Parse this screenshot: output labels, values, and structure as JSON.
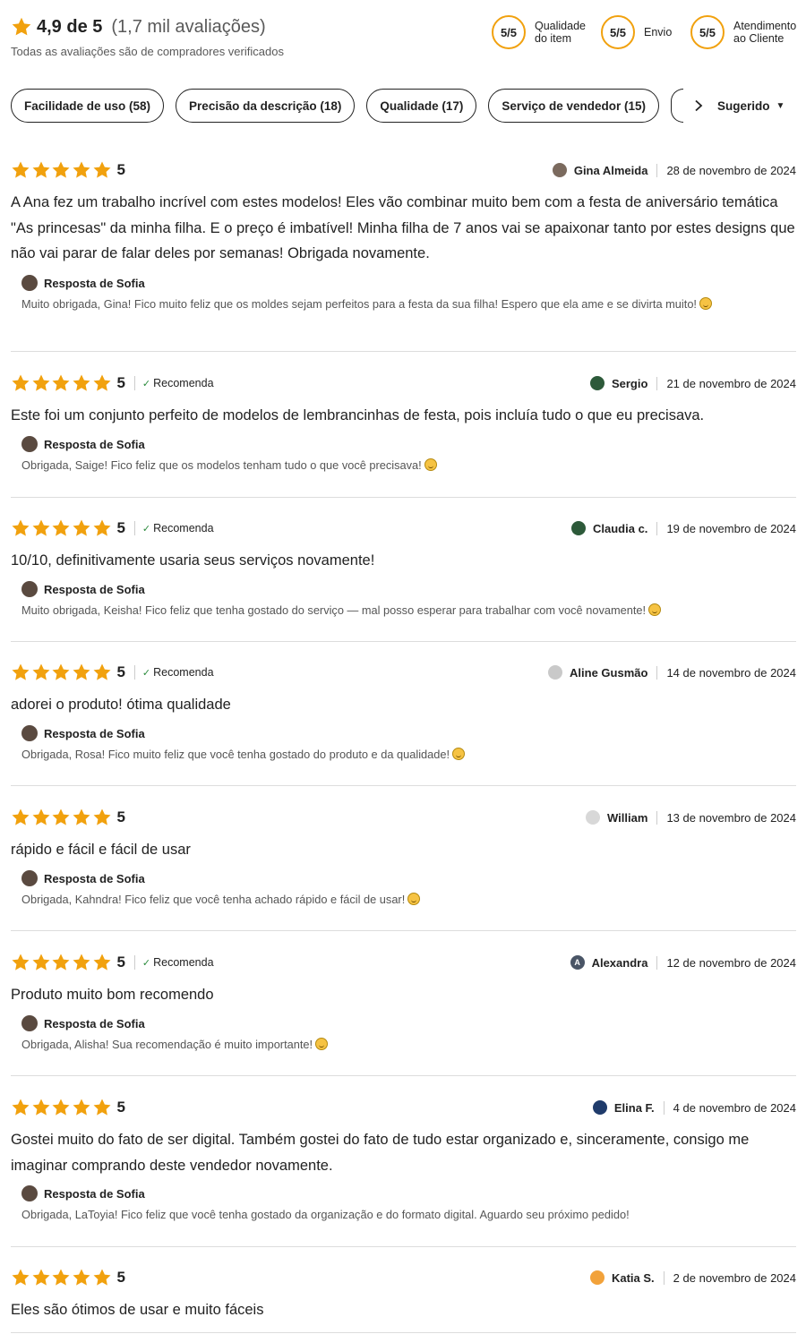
{
  "colors": {
    "star": "#f1a10e",
    "accent_ring": "#f1a10e",
    "check": "#2c8b3d",
    "divider": "#dddddd"
  },
  "header": {
    "rating_value": "4,9 de 5",
    "rating_count": "(1,7 mil avaliações)",
    "verified_note": "Todas as avaliações são de compradores verificados",
    "scores": [
      {
        "value": "5/5",
        "label": "Qualidade do item"
      },
      {
        "value": "5/5",
        "label": "Envio"
      },
      {
        "value": "5/5",
        "label": "Atendimento ao Cliente"
      }
    ]
  },
  "filters": {
    "pills": [
      "Facilidade de uso (58)",
      "Precisão da descrição (18)",
      "Qualidade (17)",
      "Serviço de vendedor (15)"
    ],
    "next_icon": "chevron-right-icon",
    "sort_label": "Sugerido",
    "sort_icon": "caret-down-icon"
  },
  "reviews": [
    {
      "stars": 5,
      "rating": "5",
      "recommends": "",
      "author": "Gina Almeida",
      "avatar_color": "#7b6a5e",
      "avatar_letter": "",
      "date": "28 de novembro de 2024",
      "text": "A Ana fez um trabalho incrível com estes modelos! Eles vão combinar muito bem com a festa de aniversário temática \"As princesas\" da minha filha. E o preço é imbatível! Minha filha de 7 anos vai se apaixonar tanto por estes designs que não vai parar de falar deles por semanas! Obrigada novamente.",
      "response_label": "Resposta de Sofia",
      "response_text": "Muito obrigada, Gina! Fico muito feliz que os moldes sejam perfeitos para a festa da sua filha! Espero que ela ame e se divirta muito!"
    },
    {
      "stars": 5,
      "rating": "5",
      "recommends": "Recomenda",
      "author": "Sergio",
      "avatar_color": "#2d5a3a",
      "avatar_letter": "",
      "date": "21 de novembro de 2024",
      "text": "Este foi um conjunto perfeito de modelos de lembrancinhas de festa, pois incluía tudo o que eu precisava.",
      "response_label": "Resposta de Sofia",
      "response_text": "Obrigada, Saige! Fico feliz que os modelos tenham tudo o que você precisava!"
    },
    {
      "stars": 5,
      "rating": "5",
      "recommends": "Recomenda",
      "author": "Claudia c.",
      "avatar_color": "#2d5a3a",
      "avatar_letter": "",
      "date": "19 de novembro de 2024",
      "text": "10/10, definitivamente usaria seus serviços novamente!",
      "response_label": "Resposta de Sofia",
      "response_text": "Muito obrigada, Keisha! Fico feliz que tenha gostado do serviço — mal posso esperar para trabalhar com você novamente!"
    },
    {
      "stars": 5,
      "rating": "5",
      "recommends": "Recomenda",
      "author": "Aline Gusmão",
      "avatar_color": "#c9c9c9",
      "avatar_letter": "",
      "date": "14 de novembro de 2024",
      "text": "adorei o produto! ótima qualidade",
      "response_label": "Resposta de Sofia",
      "response_text": "Obrigada, Rosa! Fico muito feliz que você tenha gostado do produto e da qualidade!"
    },
    {
      "stars": 5,
      "rating": "5",
      "recommends": "",
      "author": "William",
      "avatar_color": "#d8d8d8",
      "avatar_letter": "",
      "date": "13 de novembro de 2024",
      "text": "rápido e fácil e fácil de usar",
      "response_label": "Resposta de Sofia",
      "response_text": "Obrigada, Kahndra! Fico feliz que você tenha achado rápido e fácil de usar!"
    },
    {
      "stars": 5,
      "rating": "5",
      "recommends": "Recomenda",
      "author": "Alexandra",
      "avatar_color": "#4a5566",
      "avatar_letter": "A",
      "date": "12 de novembro de 2024",
      "text": "Produto muito bom recomendo",
      "response_label": "Resposta de Sofia",
      "response_text": "Obrigada, Alisha! Sua recomendação é muito importante!"
    },
    {
      "stars": 5,
      "rating": "5",
      "recommends": "",
      "author": "Elina F.",
      "avatar_color": "#1f3b6b",
      "avatar_letter": "",
      "date": "4 de novembro de 2024",
      "text": "Gostei muito do fato de ser digital. Também gostei do fato de tudo estar organizado e, sinceramente, consigo me imaginar comprando deste vendedor novamente.",
      "response_label": "Resposta de Sofia",
      "response_text": "Obrigada, LaToyia! Fico feliz que você tenha gostado da organização e do formato digital. Aguardo seu próximo pedido!"
    },
    {
      "stars": 5,
      "rating": "5",
      "recommends": "",
      "author": "Katia S.",
      "avatar_color": "#f2a23a",
      "avatar_letter": "",
      "date": "2 de novembro de 2024",
      "text": "Eles são ótimos de usar e muito fáceis",
      "response_label": "",
      "response_text": ""
    }
  ]
}
